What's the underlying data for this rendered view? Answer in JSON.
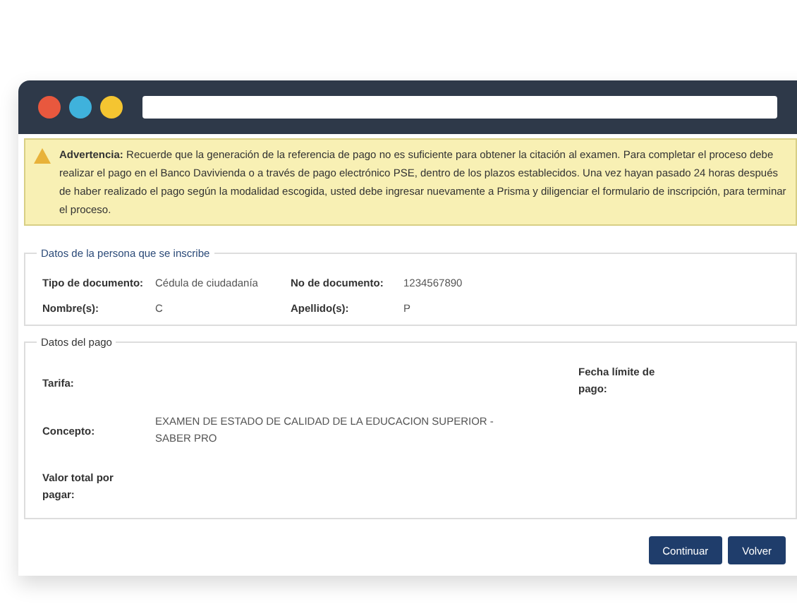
{
  "browser": {
    "dots": [
      {
        "color": "#e8583e"
      },
      {
        "color": "#3fb2dc"
      },
      {
        "color": "#f4c531"
      }
    ]
  },
  "warning": {
    "text": "**Advertencia:** Recuerde que la generación de la referencia de pago no es suficiente para obtener la citación al examen. Para completar el proceso debe realizar el pago en el Banco Davivienda o a través de pago electrónico PSE, dentro de los plazos establecidos. Una vez hayan pasado 24 horas después de haber realizado el pago según la modalidad escogida, usted debe ingresar nuevamente a Prisma y diligenciar el formulario de inscripción, para terminar el proceso."
  },
  "person": {
    "legend": "Datos de la persona que se inscribe",
    "fields": [
      {
        "label": "Tipo de documento:",
        "value": "Cédula de ciudadanía"
      },
      {
        "label": "No de documento:",
        "value": "1234567890"
      },
      {
        "label": "Nombre(s):",
        "value": "C"
      },
      {
        "label": "Apellido(s):",
        "value": "P"
      }
    ]
  },
  "payment": {
    "legend": "Datos del pago",
    "rate_label": "Tarifa:",
    "concept_label": "Concepto:",
    "concept_value": "EXAMEN DE ESTADO DE CALIDAD DE LA EDUCACION SUPERIOR - SABER PRO",
    "total_label": "Valor total por pagar:",
    "deadline_label": "Fecha límite de pago:"
  },
  "buttons": [
    "Continuar",
    "Volver"
  ]
}
